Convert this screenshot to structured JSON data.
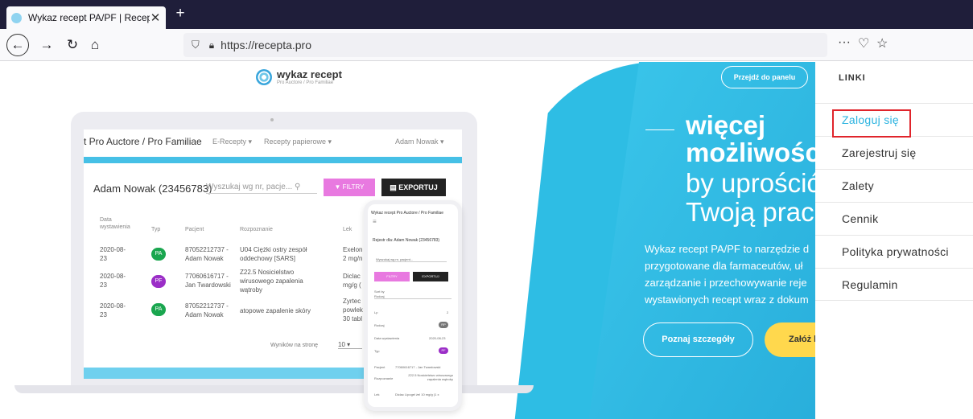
{
  "browser": {
    "tab_title": "Wykaz recept PA/PF | Recepta.p",
    "url": "https://recepta.pro",
    "more_label": "···"
  },
  "logo": {
    "title": "wykaz recept",
    "subtitle": "Pro Auctore / Pro Familiae"
  },
  "laptop": {
    "brand": "t Pro Auctore / Pro Familiae",
    "menu": [
      "E-Recepty ▾",
      "Recepty papierowe ▾"
    ],
    "user": "Adam Nowak ▾",
    "patient": "Adam Nowak (23456783)",
    "search_placeholder": "Wyszukaj wg nr, pacje...",
    "filter_label": "FILTRY",
    "export_label": "EXPORTUJ",
    "columns": [
      "Data wystawienia",
      "Typ",
      "Pacjent",
      "Rozpoznanie",
      "Lek"
    ],
    "rows": [
      {
        "date1": "2020-08-",
        "date2": "23",
        "type": "PA",
        "patient1": "87052212737 -",
        "patient2": "Adam Nowak",
        "diag1": "U04 Ciężki ostry zespół",
        "diag2": "oddechowy [SARS]",
        "drug1": "Exelon",
        "drug2": "2 mg/n"
      },
      {
        "date1": "2020-08-",
        "date2": "23",
        "type": "PF",
        "patient1": "77060616717 -",
        "patient2": "Jan Twardowski",
        "diag1": "Z22.5 Nosicielstwo",
        "diag2": "wirusowego zapalenia",
        "diag3": "wątroby",
        "drug1": "Diclac",
        "drug2": "mg/g ("
      },
      {
        "date1": "2020-08-",
        "date2": "23",
        "type": "PA",
        "patient1": "87052212737 -",
        "patient2": "Adam Nowak",
        "diag1": "atopowe zapalenie skóry",
        "drug1": "Zyrtec",
        "drug2": "powlek",
        "drug3": "30 tabl"
      }
    ],
    "per_page_label": "Wyników na stronę",
    "per_page_value": "10 ▾"
  },
  "phone": {
    "header": "Wykaz recept Pro Auctore / Pro Familiae",
    "registry": "Rejestr dla: Adam Nowak (23456783)",
    "search_placeholder": "Wyszukaj wg nr, pacjent...",
    "filter_label": "FILTRY",
    "export_label": "EXPORTUJ",
    "sort_label": "Sort by",
    "sort_value": "Rodzaj",
    "fields": [
      {
        "label": "Lp",
        "value": "2"
      },
      {
        "label": "Rodzaj",
        "value": "RP"
      },
      {
        "label": "Data wystawienia",
        "value": "2020-08-23"
      },
      {
        "label": "Typ",
        "value": "PF"
      },
      {
        "label": "Pacjent",
        "value": "77060616717 - Jan Twardowski"
      },
      {
        "label": "Rozpoznanie",
        "value": "Z22.5 Nosicielstwo wirusowego zapalenia wątroby"
      },
      {
        "label": "Lek",
        "value": "Diclac Lipogel żel 10 mg/g (1 x"
      }
    ]
  },
  "hero": {
    "panel_button": "Przejdź do panelu",
    "line1": "więcej",
    "line2": "możliwości",
    "line3": "by uprościć",
    "line4": "Twoją pracę",
    "description": [
      "Wykaz recept PA/PF to narzędzie d",
      "przygotowane dla farmaceutów, uł",
      "zarządzanie i przechowywanie reje",
      "wystawionych recept wraz z dokum"
    ],
    "more_button": "Poznaj szczegóły",
    "register_button": "Załóż k"
  },
  "side_menu": {
    "title": "LINKI",
    "items": [
      "Zaloguj się",
      "Zarejestruj się",
      "Zalety",
      "Cennik",
      "Polityka prywatności",
      "Regulamin"
    ]
  },
  "colors": {
    "brand": "#2ab3e0",
    "highlight": "#e0242b",
    "badge_pa": "#1aa64f",
    "badge_pf": "#9b2ec7"
  }
}
